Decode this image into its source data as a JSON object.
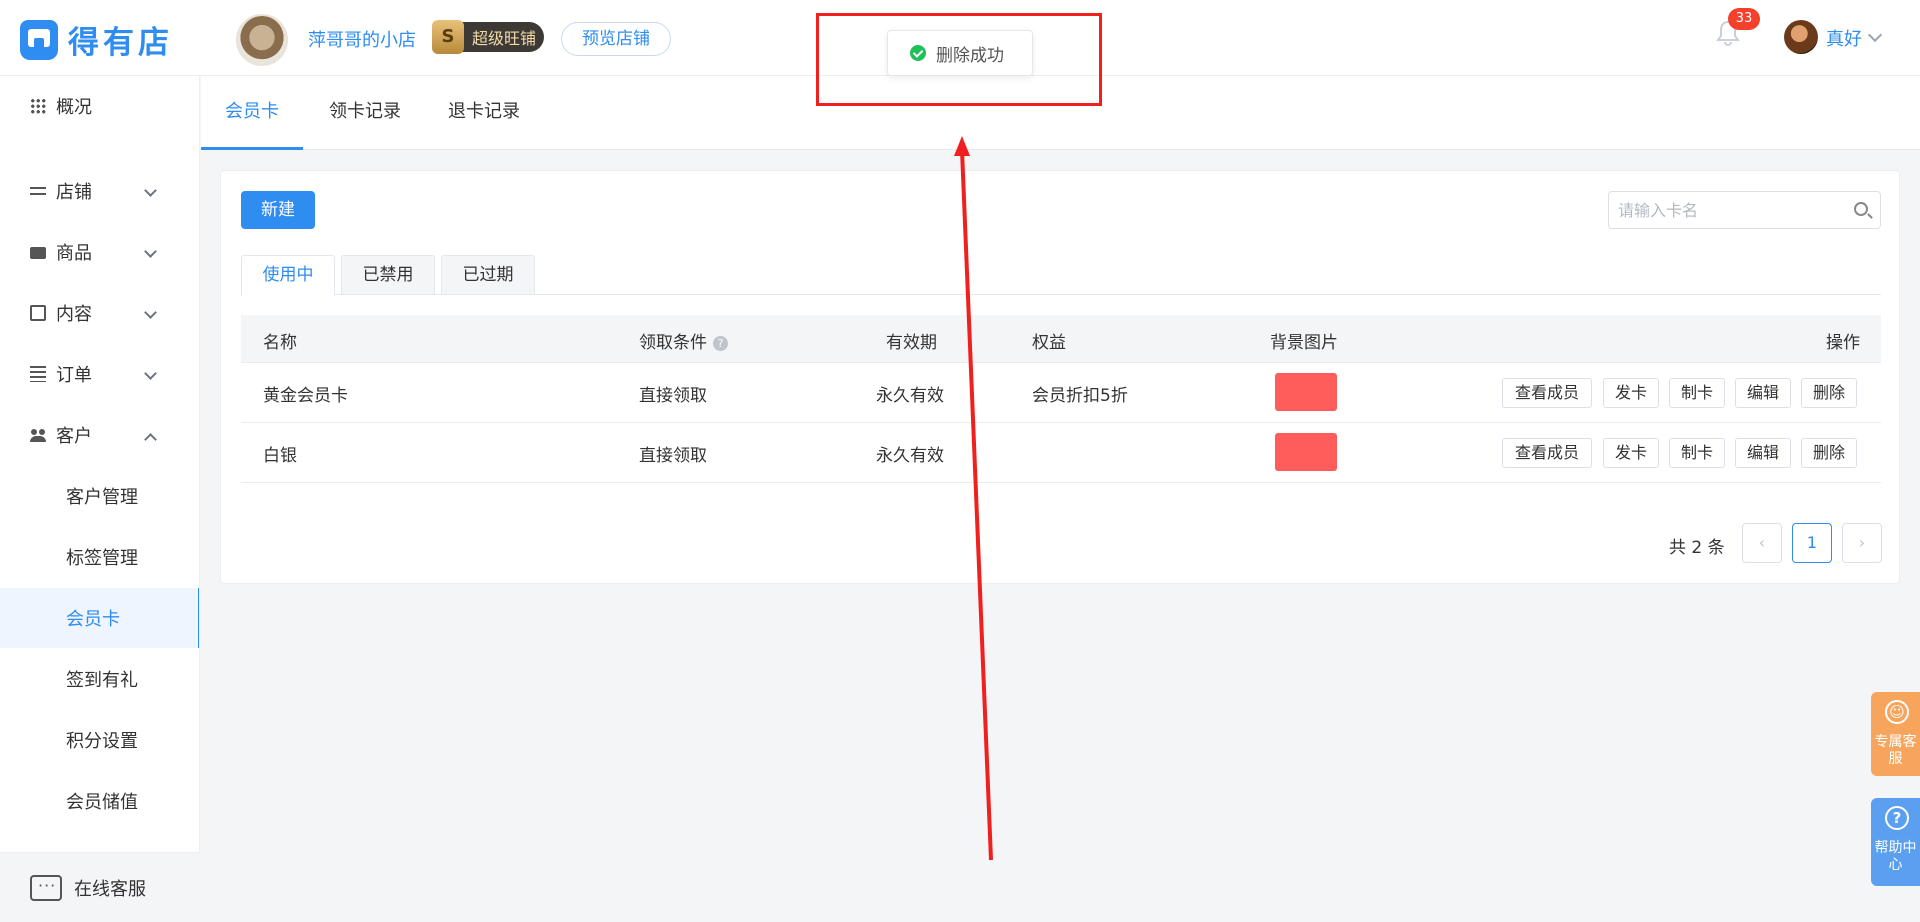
{
  "header": {
    "logo_text": "得有店",
    "shop_name": "萍哥哥的小店",
    "vip_letter": "S",
    "vip_label": "超级旺铺",
    "preview_label": "预览店铺",
    "notification_count": "33",
    "user_name": "真好"
  },
  "sidebar": {
    "items": [
      {
        "label": "概况"
      },
      {
        "label": "店铺"
      },
      {
        "label": "商品"
      },
      {
        "label": "内容"
      },
      {
        "label": "订单"
      },
      {
        "label": "客户"
      }
    ],
    "sub_items": [
      {
        "label": "客户管理"
      },
      {
        "label": "标签管理"
      },
      {
        "label": "会员卡"
      },
      {
        "label": "签到有礼"
      },
      {
        "label": "积分设置"
      },
      {
        "label": "会员储值"
      }
    ],
    "online_service": "在线客服"
  },
  "top_tabs": [
    {
      "label": "会员卡"
    },
    {
      "label": "领卡记录"
    },
    {
      "label": "退卡记录"
    }
  ],
  "toolbar": {
    "new_label": "新建",
    "search_placeholder": "请输入卡名"
  },
  "status_tabs": [
    {
      "label": "使用中"
    },
    {
      "label": "已禁用"
    },
    {
      "label": "已过期"
    }
  ],
  "table": {
    "headers": {
      "name": "名称",
      "condition": "领取条件",
      "help_icon": "?",
      "validity": "有效期",
      "benefit": "权益",
      "background": "背景图片",
      "actions": "操作"
    },
    "rows": [
      {
        "name": "黄金会员卡",
        "condition": "直接领取",
        "validity": "永久有效",
        "benefit": "会员折扣5折",
        "bg_color": "#ff5c5c"
      },
      {
        "name": "白银",
        "condition": "直接领取",
        "validity": "永久有效",
        "benefit": "",
        "bg_color": "#ff5c5c"
      }
    ],
    "action_labels": {
      "view_members": "查看成员",
      "issue": "发卡",
      "make": "制卡",
      "edit": "编辑",
      "delete": "删除"
    }
  },
  "pagination": {
    "total_text": "共 2 条",
    "prev": "‹",
    "current_page": "1",
    "next": "›"
  },
  "toast": {
    "message": "删除成功"
  },
  "floating": {
    "support_icon": "☺",
    "support_label": "专属客服",
    "help_icon": "?",
    "help_label": "帮助中心"
  },
  "colors": {
    "accent": "#2f8cf0",
    "annotation_red": "#f0201e",
    "success": "#1fbf5a"
  }
}
